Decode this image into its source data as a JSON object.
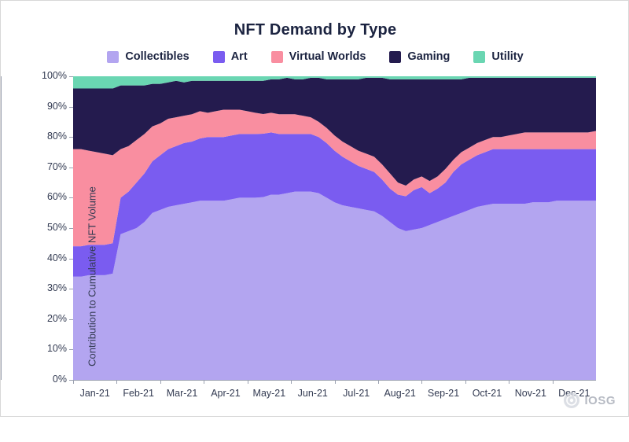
{
  "chart_data": {
    "type": "area",
    "title": "NFT Demand by Type",
    "xlabel": "",
    "ylabel": "Contribution to Cumulative NFT Volume",
    "stacked": true,
    "percent": true,
    "ylim": [
      0,
      100
    ],
    "yticks": [
      "0%",
      "10%",
      "20%",
      "30%",
      "40%",
      "50%",
      "60%",
      "70%",
      "80%",
      "90%",
      "100%"
    ],
    "xticks": [
      "Jan-21",
      "Feb-21",
      "Mar-21",
      "Apr-21",
      "May-21",
      "Jun-21",
      "Jul-21",
      "Aug-21",
      "Sep-21",
      "Oct-21",
      "Nov-21",
      "Dec-21"
    ],
    "grid": false,
    "legend_position": "top",
    "legend": [
      "Collectibles",
      "Art",
      "Virtual Worlds",
      "Gaming",
      "Utility"
    ],
    "colors": {
      "Collectibles": "#b3a5f0",
      "Art": "#7a5cf0",
      "Virtual Worlds": "#f98ea0",
      "Gaming": "#241b4e",
      "Utility": "#6ad6b2"
    },
    "x": [
      0,
      1,
      2,
      3,
      4,
      5,
      6,
      7,
      8,
      9,
      10,
      11,
      12,
      13,
      14,
      15,
      16,
      17,
      18,
      19,
      20,
      21,
      22,
      23,
      24,
      25,
      26,
      27,
      28,
      29,
      30,
      31,
      32,
      33,
      34,
      35,
      36,
      37,
      38,
      39,
      40,
      41,
      42,
      43,
      44,
      45,
      46,
      47,
      48,
      49,
      50,
      51,
      52,
      53,
      54,
      55,
      56,
      57,
      58,
      59,
      60,
      61,
      62,
      63,
      64,
      65,
      66
    ],
    "series": [
      {
        "name": "Collectibles",
        "values": [
          34,
          34,
          34.5,
          34.5,
          34.5,
          35,
          48,
          49,
          50,
          52,
          55,
          56,
          57,
          57.5,
          58,
          58.5,
          59,
          59,
          59,
          59,
          59.5,
          60,
          60,
          60,
          60.5,
          61,
          61,
          61.5,
          62,
          62,
          62,
          61.5,
          60,
          58.5,
          57.5,
          57,
          56.5,
          56,
          55.5,
          54,
          52,
          50,
          49,
          49.5,
          50,
          51,
          52,
          53,
          54,
          55,
          56,
          57,
          57.5,
          58,
          58,
          58,
          58,
          58,
          58.5,
          58.5,
          58.5,
          59,
          59,
          59,
          59,
          59,
          59
        ]
      },
      {
        "name": "Art",
        "values": [
          10,
          10,
          10,
          10,
          10,
          10,
          12,
          13,
          15,
          16,
          17,
          18,
          19,
          19.5,
          20,
          20,
          20.5,
          21,
          21,
          21,
          21,
          21,
          21,
          21,
          21,
          20.5,
          20,
          19.5,
          19,
          19,
          19,
          18.5,
          18,
          17,
          16,
          15,
          14,
          13.5,
          13,
          12,
          11,
          11,
          11.5,
          13,
          13.5,
          10.5,
          11,
          12,
          14.5,
          16,
          16.5,
          17,
          17.5,
          18,
          18,
          18,
          18,
          18,
          17.5,
          17.5,
          17.5,
          17,
          17,
          17,
          17,
          17,
          17
        ]
      },
      {
        "name": "Virtual Worlds",
        "values": [
          32,
          32,
          31,
          30.5,
          30,
          29,
          16,
          15,
          14,
          13,
          11.5,
          10.5,
          10,
          9.5,
          9,
          9,
          9,
          8,
          8.5,
          9,
          8.5,
          8,
          7.5,
          7,
          6.5,
          6.5,
          6.5,
          6.5,
          6.5,
          6,
          5.5,
          5,
          5,
          5,
          5,
          5,
          5,
          5,
          5,
          5,
          5,
          4,
          3.5,
          3.5,
          3.5,
          4,
          4,
          4.5,
          4,
          4,
          4,
          4,
          4,
          4,
          4,
          4.5,
          5,
          5.5,
          5.5,
          5.5,
          5.5,
          5.5,
          5.5,
          5.5,
          5.5,
          5.5,
          6
        ]
      },
      {
        "name": "Gaming",
        "values": [
          20,
          20,
          20.5,
          21,
          21.5,
          22,
          21,
          20,
          18,
          16,
          14,
          13,
          12,
          12,
          11,
          11,
          10,
          10.5,
          10,
          9.5,
          9.5,
          9.5,
          10,
          10.5,
          11,
          11,
          11.5,
          12,
          11.5,
          12,
          13,
          14.5,
          16,
          18.5,
          20.5,
          22,
          23.5,
          25,
          26,
          28.5,
          31,
          34,
          35,
          33,
          32,
          33.5,
          32,
          29.5,
          26.5,
          24,
          23,
          21.5,
          20.5,
          19.5,
          19.5,
          19,
          18.5,
          18,
          18,
          18,
          18,
          18,
          18,
          18,
          18,
          18,
          17.5
        ]
      },
      {
        "name": "Utility",
        "values": [
          4,
          4,
          4,
          4,
          4,
          4,
          3,
          3,
          3,
          3,
          2.5,
          2.5,
          2,
          1.5,
          2,
          1.5,
          1.5,
          1.5,
          1.5,
          1.5,
          1.5,
          1.5,
          1.5,
          1.5,
          1.5,
          1,
          1,
          0.5,
          1,
          1,
          0.5,
          0.5,
          1,
          1,
          1,
          1,
          1,
          0.5,
          0.5,
          0.5,
          1,
          1,
          1,
          1,
          1,
          1,
          1,
          1,
          1,
          1,
          0.5,
          0.5,
          0.5,
          0.5,
          0.5,
          0.5,
          0.5,
          0.5,
          0.5,
          0.5,
          0.5,
          0.5,
          0.5,
          0.5,
          0.5,
          0.5,
          0.5
        ]
      }
    ]
  },
  "watermark": {
    "text": "IOSG",
    "logo": "circle-logo-icon"
  }
}
